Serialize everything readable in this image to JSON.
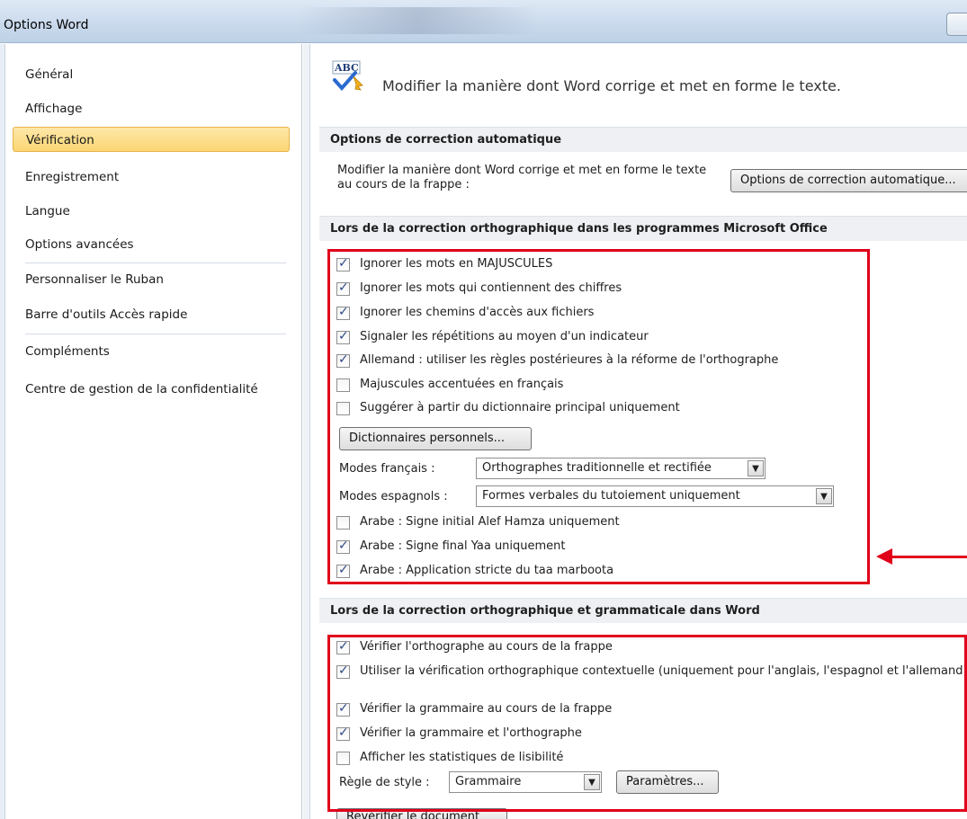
{
  "window": {
    "title": "Options Word"
  },
  "sidebar": {
    "items": [
      {
        "label": "Général"
      },
      {
        "label": "Affichage"
      },
      {
        "label": "Vérification"
      },
      {
        "label": "Enregistrement"
      },
      {
        "label": "Langue"
      },
      {
        "label": "Options avancées"
      },
      {
        "label": "Personnaliser le Ruban"
      },
      {
        "label": "Barre d'outils Accès rapide"
      },
      {
        "label": "Compléments"
      },
      {
        "label": "Centre de gestion de la confidentialité"
      }
    ],
    "selected": "Vérification"
  },
  "header": {
    "text": "Modifier la manière dont Word corrige et met en forme le texte.",
    "icon": "abc-spellcheck-icon"
  },
  "autocorrect": {
    "section_title": "Options de correction automatique",
    "description": "Modifier la manière dont Word corrige et met en forme le texte au cours de la frappe :",
    "button": "Options de correction automatique..."
  },
  "office_spelling": {
    "section_title": "Lors de la correction orthographique dans les programmes Microsoft Office",
    "checkboxes": [
      {
        "label": "Ignorer les mots en MAJUSCULES",
        "checked": true
      },
      {
        "label": "Ignorer les mots qui contiennent des chiffres",
        "checked": true
      },
      {
        "label": "Ignorer les chemins d'accès aux fichiers",
        "checked": true
      },
      {
        "label": "Signaler les répétitions au moyen d'un indicateur",
        "checked": true
      },
      {
        "label": "Allemand : utiliser les règles postérieures à la réforme de l'orthographe",
        "checked": true
      },
      {
        "label": "Majuscules accentuées en français",
        "checked": false
      },
      {
        "label": "Suggérer à partir du dictionnaire principal uniquement",
        "checked": false
      }
    ],
    "dictionaries_button": "Dictionnaires personnels...",
    "french_modes": {
      "label": "Modes français :",
      "value": "Orthographes traditionnelle et rectifiée"
    },
    "spanish_modes": {
      "label": "Modes espagnols :",
      "value": "Formes verbales du tutoiement uniquement"
    },
    "arabic_checkboxes": [
      {
        "label": "Arabe : Signe initial Alef Hamza uniquement",
        "checked": false
      },
      {
        "label": "Arabe : Signe final Yaa uniquement",
        "checked": true
      },
      {
        "label": "Arabe : Application stricte du taa marboota",
        "checked": true
      }
    ]
  },
  "word_spelling": {
    "section_title": "Lors de la correction orthographique et grammaticale dans Word",
    "checkboxes": [
      {
        "label": "Vérifier l'orthographe au cours de la frappe",
        "checked": true
      },
      {
        "label": "Utiliser la vérification orthographique contextuelle (uniquement pour l'anglais, l'espagnol et l'allemand)",
        "checked": true
      },
      {
        "label": "Vérifier la grammaire au cours de la frappe",
        "checked": true
      },
      {
        "label": "Vérifier la grammaire et l'orthographe",
        "checked": true
      },
      {
        "label": "Afficher les statistiques de lisibilité",
        "checked": false
      }
    ],
    "style_rule": {
      "label": "Règle de style :",
      "value": "Grammaire"
    },
    "settings_button": "Paramètres...",
    "recheck_button": "Revérifier le document"
  },
  "colors": {
    "highlight": "#e0001a",
    "selected_nav": "#fbd673",
    "section_bar": "#eef0f3"
  }
}
